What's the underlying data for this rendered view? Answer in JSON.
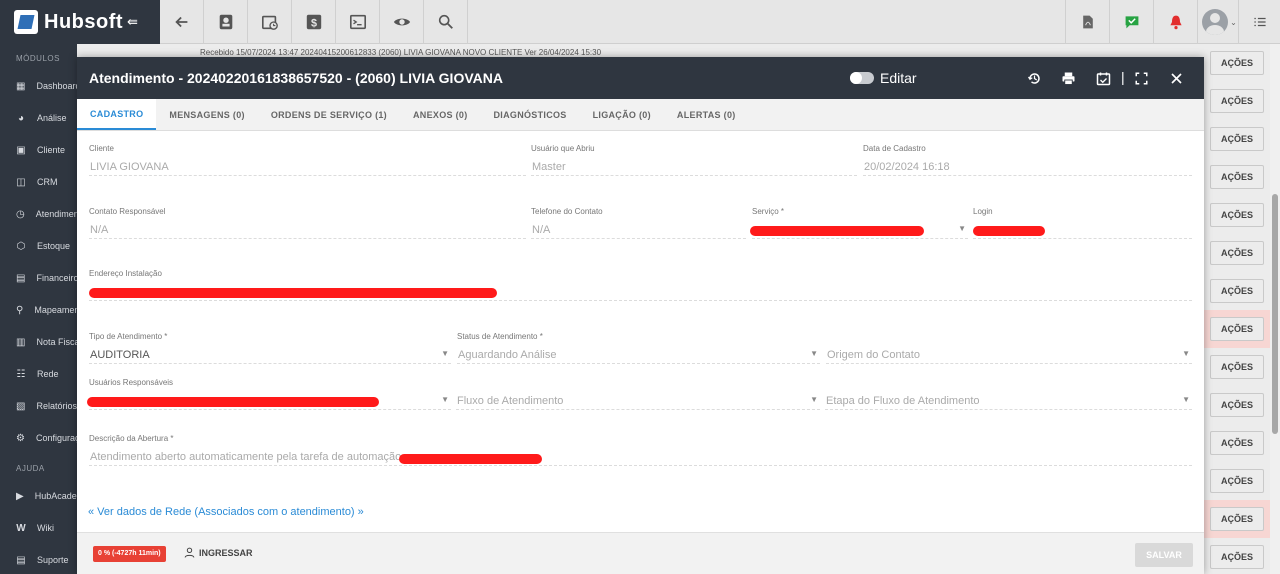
{
  "app": {
    "name": "Hubsoft",
    "collapse_glyph": "⇚"
  },
  "toolbar": {
    "icons": [
      "back-arrow-icon",
      "contact-card-icon",
      "calendar-clock-icon",
      "dollar-icon",
      "terminal-icon",
      "eye-icon",
      "search-icon"
    ],
    "right_icons": [
      "pdf-icon",
      "chat-check-icon",
      "alarm-bell-icon",
      "user-avatar",
      "menu-list-icon"
    ]
  },
  "sidebar": {
    "section_modules": "MÓDULOS",
    "items": [
      {
        "label": "Dashboard",
        "icon": "grid-icon"
      },
      {
        "label": "Análise",
        "icon": "pie-chart-icon"
      },
      {
        "label": "Cliente",
        "icon": "id-card-icon"
      },
      {
        "label": "CRM",
        "icon": "crm-icon"
      },
      {
        "label": "Atendimento",
        "icon": "calendar-clock-icon"
      },
      {
        "label": "Estoque",
        "icon": "cube-icon"
      },
      {
        "label": "Financeiro",
        "icon": "money-icon"
      },
      {
        "label": "Mapeamento",
        "icon": "map-pin-icon"
      },
      {
        "label": "Nota Fiscal",
        "icon": "document-icon"
      },
      {
        "label": "Rede",
        "icon": "network-icon"
      },
      {
        "label": "Relatórios",
        "icon": "report-icon"
      },
      {
        "label": "Configurações",
        "icon": "gear-icon"
      }
    ],
    "section_help": "AJUDA",
    "help_items": [
      {
        "label": "HubAcademy",
        "icon": "play-icon"
      },
      {
        "label": "Wiki",
        "icon": "wiki-icon"
      },
      {
        "label": "Suporte",
        "icon": "support-icon"
      }
    ]
  },
  "background": {
    "row_text": "Recebido 15/07/2024 13:47     20240415200612833     (2060) LIVIA GIOVANA     NOVO CLIENTE     Ver     26/04/2024 15:30",
    "action_label": "AÇÕES",
    "rows": 14
  },
  "modal": {
    "title": "Atendimento - 20240220161838657520 - (2060) LIVIA GIOVANA",
    "edit_label": "Editar",
    "header_icons": [
      "history-icon",
      "print-icon",
      "calendar-check-icon",
      "fullscreen-icon",
      "close-icon"
    ],
    "separator": "|",
    "tabs": [
      {
        "label": "CADASTRO",
        "active": true
      },
      {
        "label": "MENSAGENS (0)",
        "active": false
      },
      {
        "label": "ORDENS DE SERVIÇO (1)",
        "active": false
      },
      {
        "label": "ANEXOS (0)",
        "active": false
      },
      {
        "label": "DIAGNÓSTICOS",
        "active": false
      },
      {
        "label": "LIGAÇÃO (0)",
        "active": false
      },
      {
        "label": "ALERTAS (0)",
        "active": false
      }
    ],
    "fields": {
      "cliente": {
        "label": "Cliente",
        "value": "LIVIA GIOVANA"
      },
      "usuario_abriu": {
        "label": "Usuário que Abriu",
        "value": "Master"
      },
      "data_cadastro": {
        "label": "Data de Cadastro",
        "value": "20/02/2024 16:18"
      },
      "contato_responsavel": {
        "label": "Contato Responsável",
        "value": "N/A"
      },
      "telefone_contato": {
        "label": "Telefone do Contato",
        "value": "N/A"
      },
      "servico": {
        "label": "Serviço *",
        "value": ""
      },
      "login": {
        "label": "Login",
        "value": ""
      },
      "endereco_instalacao": {
        "label": "Endereço Instalação",
        "value": ""
      },
      "tipo_atendimento": {
        "label": "Tipo de Atendimento *",
        "value": "AUDITORIA"
      },
      "status_atendimento": {
        "label": "Status de Atendimento *",
        "value": "Aguardando Análise"
      },
      "origem_contato": {
        "label": "",
        "value": "Origem do Contato"
      },
      "usuarios_responsaveis": {
        "label": "Usuários Responsáveis",
        "value": ""
      },
      "fluxo_atendimento": {
        "label": "",
        "value": "Fluxo de Atendimento"
      },
      "etapa_fluxo": {
        "label": "",
        "value": "Etapa do Fluxo de Atendimento"
      },
      "descricao_abertura": {
        "label": "Descrição da Abertura *",
        "value": "Atendimento aberto automaticamente pela tarefa de automação"
      }
    },
    "link_rede": "« Ver dados de Rede (Associados com o atendimento) »",
    "footer": {
      "timer_badge": "0 % (-4727h 11min)",
      "ingressar": "INGRESSAR",
      "salvar": "SALVAR"
    }
  },
  "colors": {
    "accent": "#2a8bd6",
    "header_dark": "#2f3640",
    "danger": "#e84135",
    "redaction": "#ff1a1a"
  }
}
